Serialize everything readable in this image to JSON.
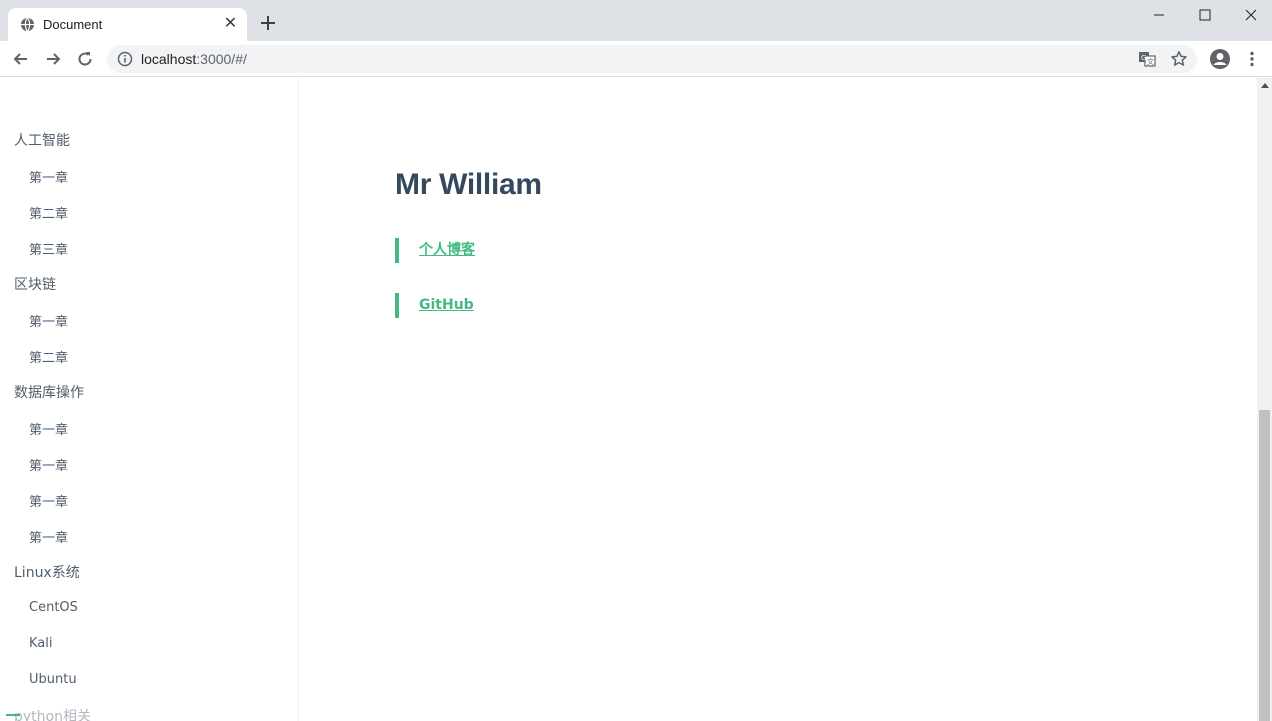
{
  "browser": {
    "tab_title": "Document",
    "url_host": "localhost",
    "url_rest": ":3000/#/"
  },
  "sidebar": {
    "groups": [
      {
        "label": "人工智能",
        "items": [
          "第一章",
          "第二章",
          "第三章"
        ]
      },
      {
        "label": "区块链",
        "items": [
          "第一章",
          "第二章"
        ]
      },
      {
        "label": "数据库操作",
        "items": [
          "第一章",
          "第一章",
          "第一章",
          "第一章"
        ]
      },
      {
        "label": "Linux系统",
        "items": [
          "CentOS",
          "Kali",
          "Ubuntu"
        ]
      }
    ],
    "partial_group": "python相关"
  },
  "main": {
    "title": "Mr William",
    "links": [
      "个人博客",
      "GitHub"
    ]
  },
  "colors": {
    "accent": "#42b983",
    "heading": "#34495e",
    "sidebar_text": "#505d6b"
  }
}
